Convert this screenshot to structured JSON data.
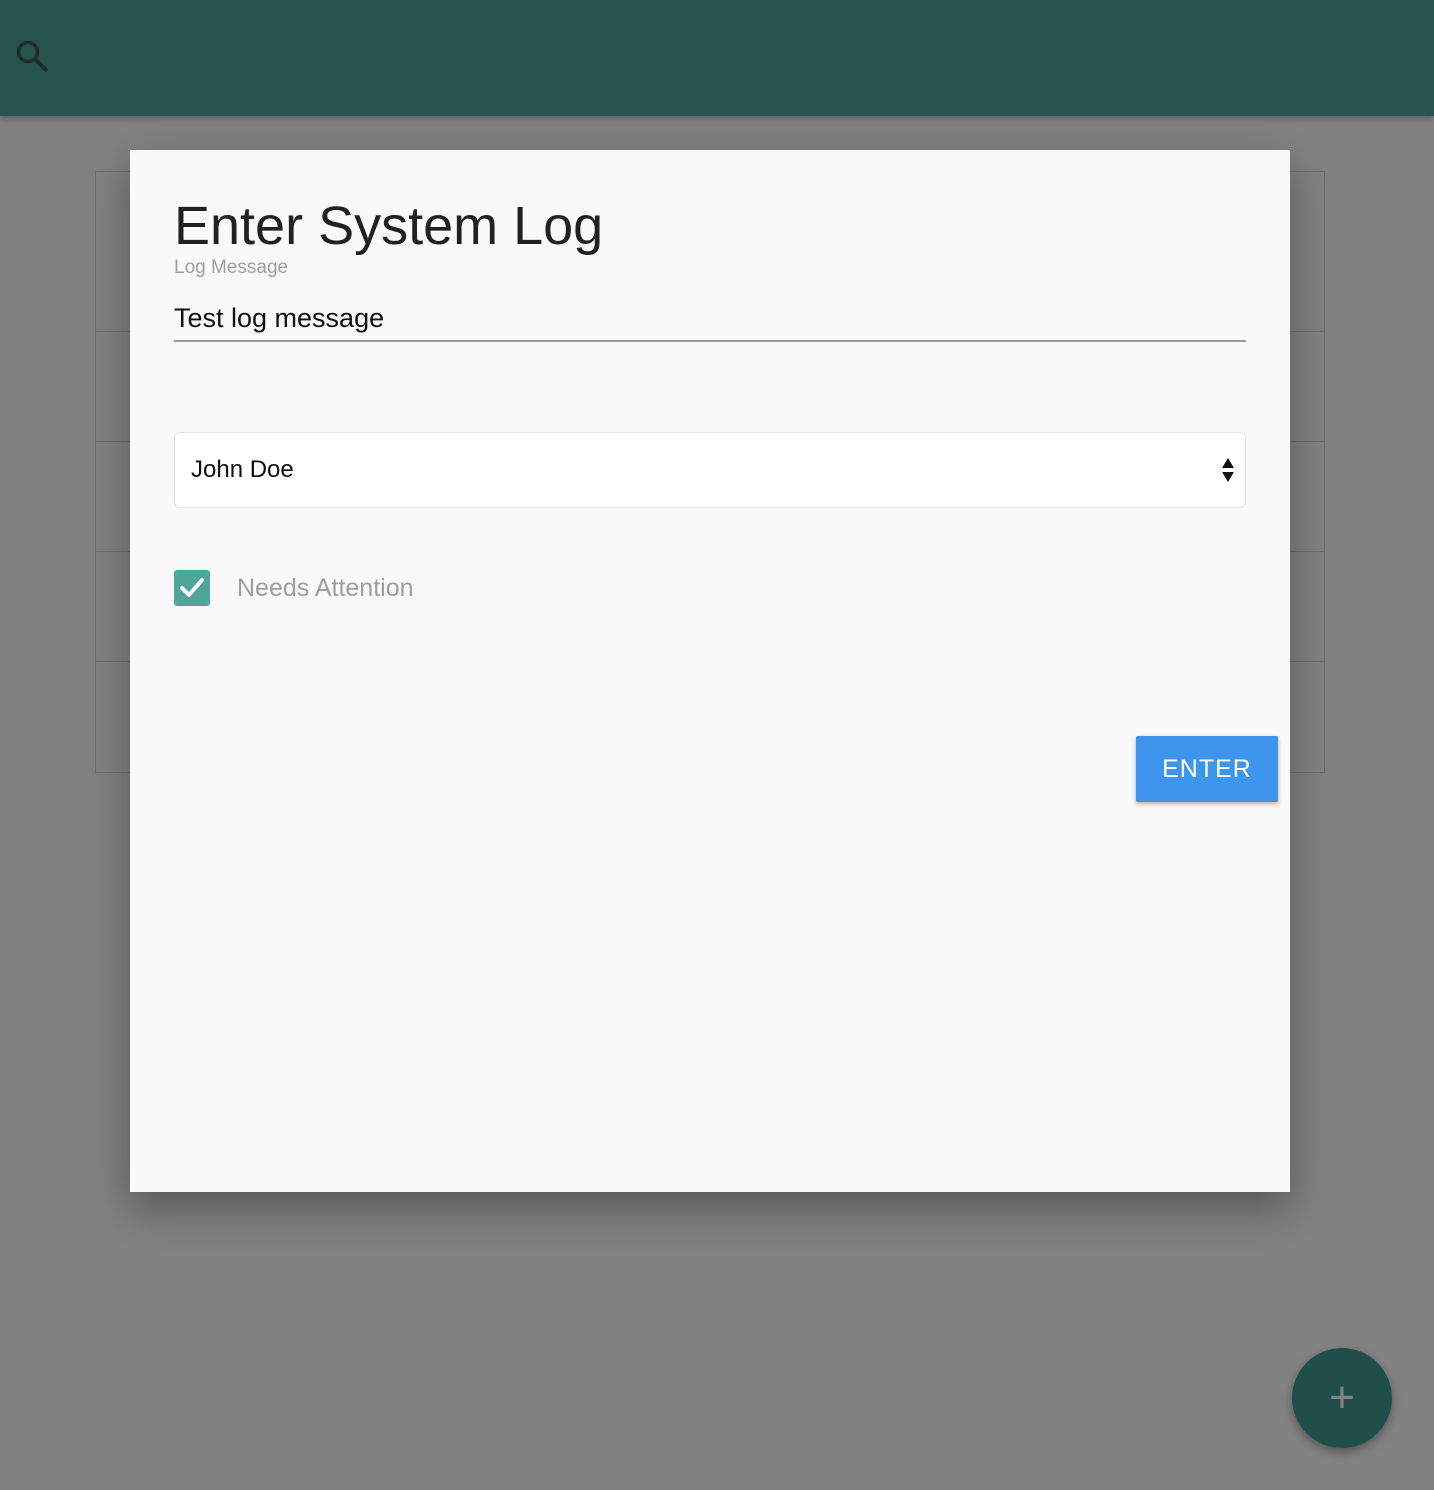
{
  "app": {
    "search_icon": "search-icon",
    "fab_label": "+",
    "brand_color": "#4ea69b"
  },
  "dialog": {
    "title": "Enter System Log",
    "message_label": "Log Message",
    "message_value": "Test log message",
    "user_select_value": "John Doe",
    "needs_attention_label": "Needs Attention",
    "needs_attention_checked": true,
    "submit_label": "ENTER",
    "button_color": "#3d95ee"
  }
}
